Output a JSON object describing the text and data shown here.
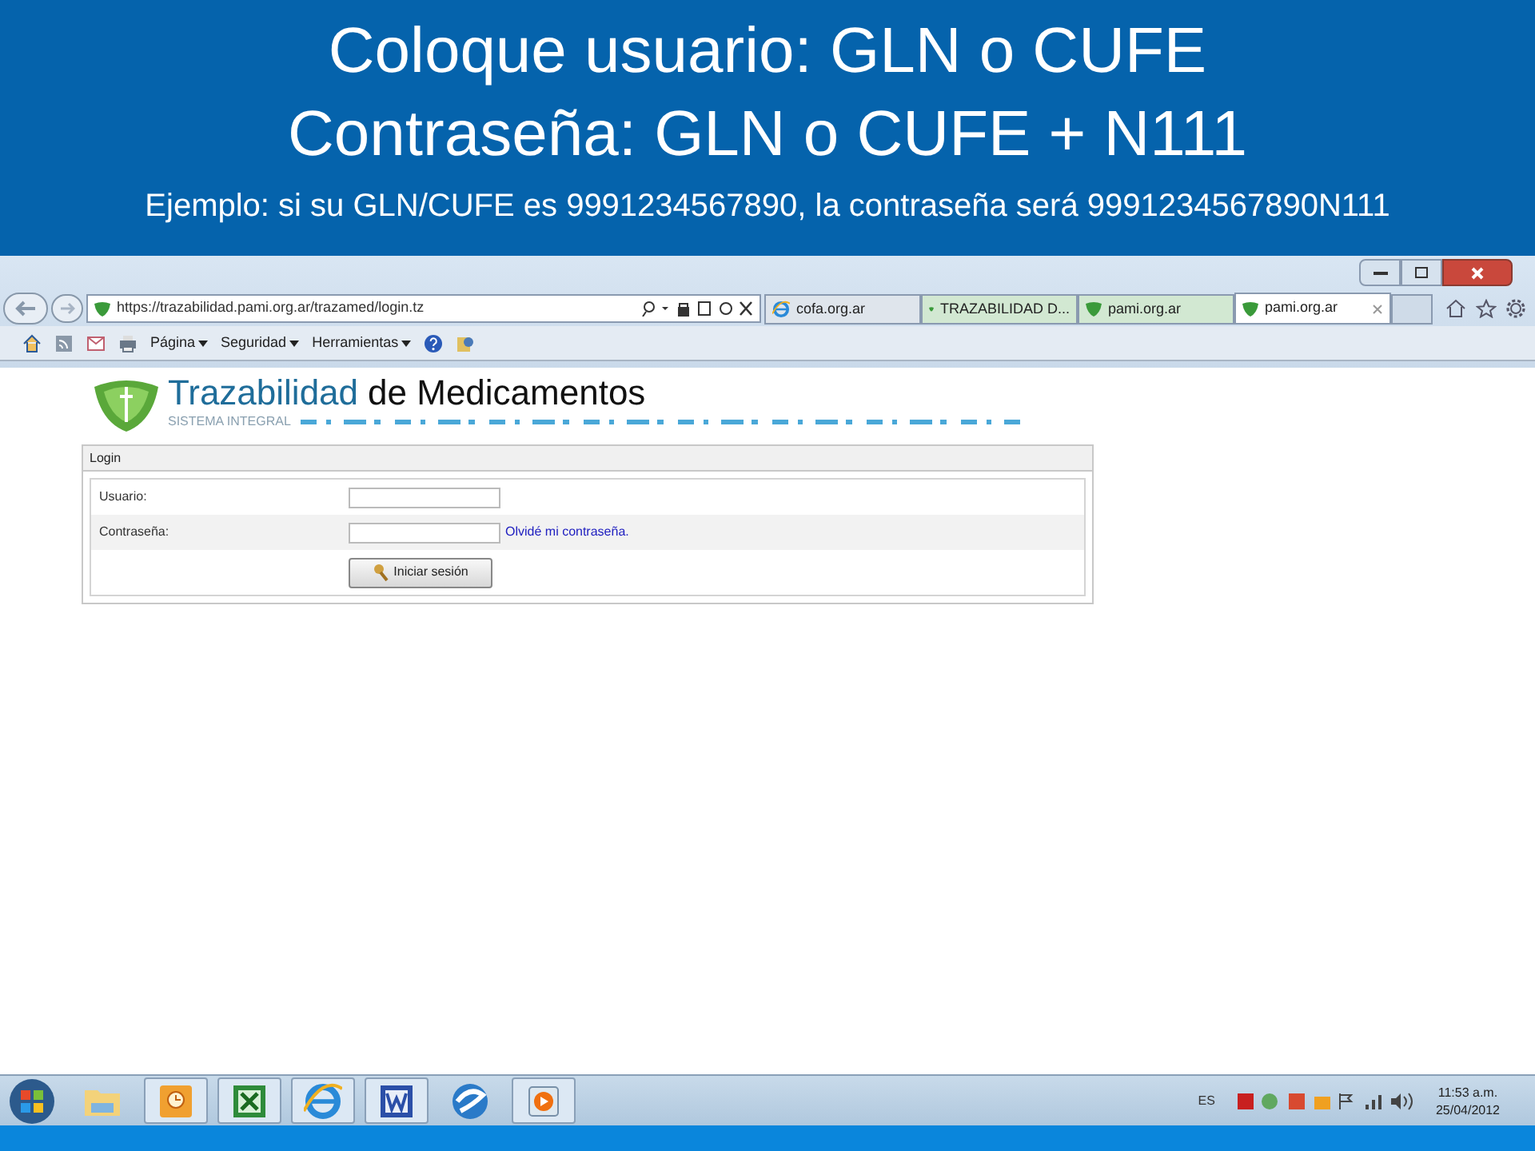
{
  "slide": {
    "lines": [
      {
        "text": "Coloque usuario: GLN o CUFE",
        "kind": "big"
      },
      {
        "text": "Contraseña: GLN o CUFE + N111",
        "kind": "big"
      },
      {
        "text": "Ejemplo: si su GLN/CUFE es 9991234567890,  la contraseña será 9991234567890N111",
        "kind": "small"
      }
    ]
  },
  "browser": {
    "address": "https://trazabilidad.pami.org.ar/trazamed/login.tz",
    "tabs": [
      {
        "label": "cofa.org.ar",
        "selected": false,
        "kind": "ie"
      },
      {
        "label": "TRAZABILIDAD D...",
        "selected": false,
        "kind": "shield"
      },
      {
        "label": "pami.org.ar",
        "selected": false,
        "kind": "shield"
      },
      {
        "label": "pami.org.ar",
        "selected": true,
        "kind": "shield"
      }
    ],
    "menus": [
      "Página",
      "Seguridad",
      "Herramientas"
    ]
  },
  "page": {
    "brand": "Trazabilidad",
    "brand_rest": "de Medicamentos",
    "subtitle": "SISTEMA INTEGRAL",
    "panel_title": "Login",
    "fields": [
      {
        "label": "Usuario:"
      },
      {
        "label": "Contraseña:",
        "link": "Olvidé mi contraseña."
      }
    ],
    "button": "Iniciar sesión"
  },
  "taskbar": {
    "apps": [
      {
        "kind": "folder",
        "running": false
      },
      {
        "kind": "outlook",
        "running": true
      },
      {
        "kind": "excel",
        "running": true
      },
      {
        "kind": "ie",
        "running": true
      },
      {
        "kind": "word",
        "running": true
      },
      {
        "kind": "globe",
        "running": false
      },
      {
        "kind": "media",
        "running": true
      }
    ],
    "language": "ES",
    "time": "11:53 a.m.",
    "date": "25/04/2012"
  }
}
